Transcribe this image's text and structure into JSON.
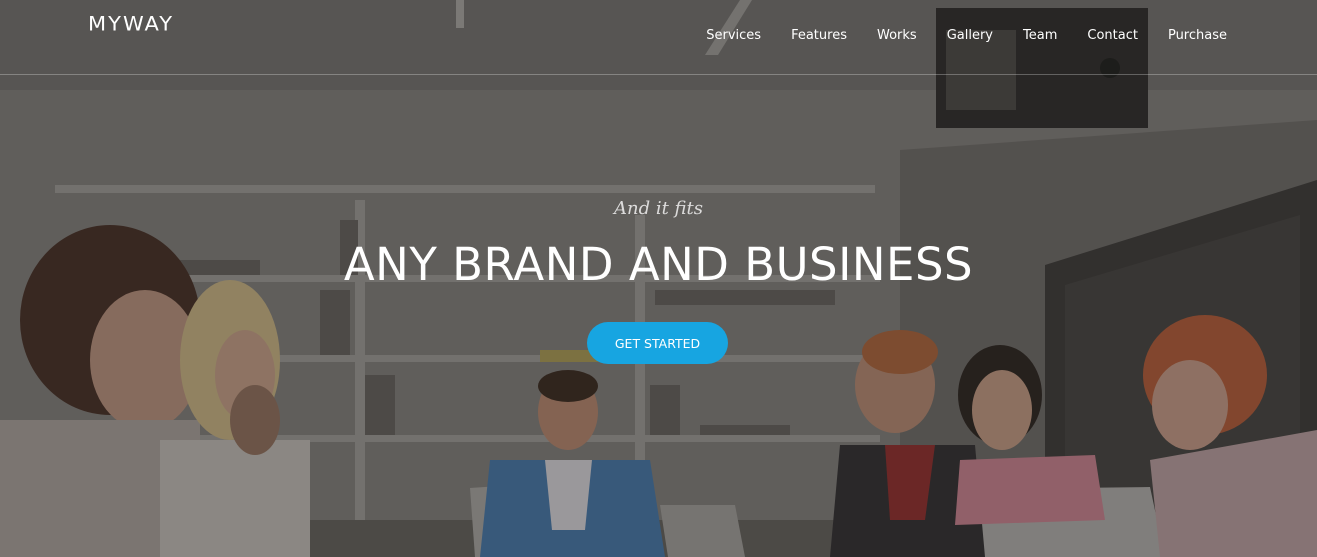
{
  "brand": {
    "logo_text": "MYWAY"
  },
  "nav": {
    "items": [
      {
        "label": "Services"
      },
      {
        "label": "Features"
      },
      {
        "label": "Works"
      },
      {
        "label": "Gallery"
      },
      {
        "label": "Team"
      },
      {
        "label": "Contact"
      },
      {
        "label": "Purchase"
      }
    ]
  },
  "hero": {
    "tagline": "And it fits",
    "headline": "ANY BRAND AND BUSINESS",
    "cta_label": "GET STARTED",
    "background_description_icon": "office-meeting-photo"
  },
  "colors": {
    "accent": "#17a5e1",
    "text": "#ffffff",
    "overlay": "#1e1c1b"
  }
}
